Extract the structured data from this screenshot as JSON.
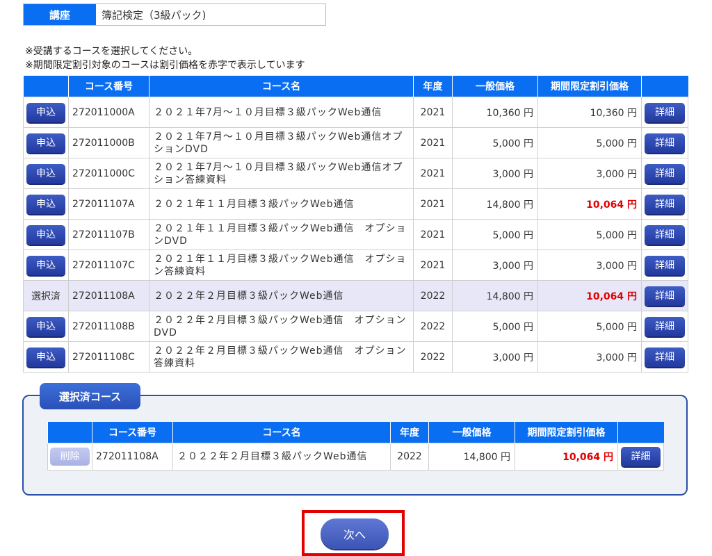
{
  "koza": {
    "label": "講座",
    "value": "簿記検定（3級パック)"
  },
  "notes": {
    "line1": "※受講するコースを選択してください。",
    "line2": "※期間限定割引対象のコースは割引価格を赤字で表示しています"
  },
  "table": {
    "headers": [
      "",
      "コース番号",
      "コース名",
      "年度",
      "一般価格",
      "期間限定割引価格",
      ""
    ],
    "apply_label": "申込",
    "detail_label": "詳細",
    "selected_label": "選択済",
    "rows": [
      {
        "code": "272011000A",
        "name": "２０２１年7月～１０月目標３級パックWeb通信",
        "year": "2021",
        "price": "10,360 円",
        "disc": "10,360 円"
      },
      {
        "code": "272011000B",
        "name": "２０２１年7月～１０月目標３級パックWeb通信オプションDVD",
        "year": "2021",
        "price": "5,000 円",
        "disc": "5,000 円"
      },
      {
        "code": "272011000C",
        "name": "２０２１年7月～１０月目標３級パックWeb通信オプション答練資料",
        "year": "2021",
        "price": "3,000 円",
        "disc": "3,000 円"
      },
      {
        "code": "272011107A",
        "name": "２０２１年１１月目標３級パックWeb通信",
        "year": "2021",
        "price": "14,800 円",
        "disc": "10,064 円"
      },
      {
        "code": "272011107B",
        "name": "２０２１年１１月目標３級パックWeb通信　オプションDVD",
        "year": "2021",
        "price": "5,000 円",
        "disc": "5,000 円"
      },
      {
        "code": "272011107C",
        "name": "２０２１年１１月目標３級パックWeb通信　オプション答練資料",
        "year": "2021",
        "price": "3,000 円",
        "disc": "3,000 円"
      },
      {
        "code": "272011108A",
        "name": "２０２２年２月目標３級パックWeb通信",
        "year": "2022",
        "price": "14,800 円",
        "disc": "10,064 円"
      },
      {
        "code": "272011108B",
        "name": "２０２２年２月目標３級パックWeb通信　オプションDVD",
        "year": "2022",
        "price": "5,000 円",
        "disc": "5,000 円"
      },
      {
        "code": "272011108C",
        "name": "２０２２年２月目標３級パックWeb通信　オプション答練資料",
        "year": "2022",
        "price": "3,000 円",
        "disc": "3,000 円"
      }
    ]
  },
  "selected": {
    "title": "選択済コース",
    "headers": [
      "",
      "コース番号",
      "コース名",
      "年度",
      "一般価格",
      "期間限定割引価格",
      ""
    ],
    "delete_label": "削除",
    "detail_label": "詳細",
    "row": {
      "code": "272011108A",
      "name": "２０２２年２月目標３級パックWeb通信",
      "year": "2022",
      "price": "14,800 円",
      "disc": "10,064 円"
    }
  },
  "next_label": "次へ",
  "colors": {
    "header_blue": "#0a6ef2",
    "discount_red": "#e00000",
    "highlight_red": "#e20000"
  }
}
